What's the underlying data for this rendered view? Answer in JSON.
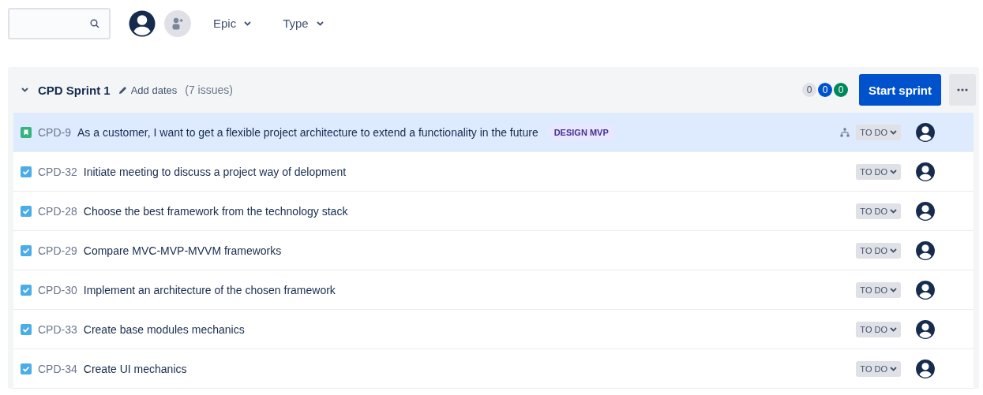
{
  "filters": [
    {
      "label": "Epic"
    },
    {
      "label": "Type"
    }
  ],
  "sprint": {
    "name": "CPD Sprint 1",
    "expanded": true,
    "add_dates": "Add dates",
    "issue_count": "(7 issues)",
    "counts": [
      {
        "value": "0",
        "color": "#dfe1e6"
      },
      {
        "value": "0",
        "color": "#0052cc"
      },
      {
        "value": "0",
        "color": "#00875a"
      }
    ],
    "start_button": "Start sprint"
  },
  "issues": [
    {
      "kind": "story",
      "key": "CPD-9",
      "summary": "As a customer, I want to get a flexible project architecture to extend a functionality in the future",
      "epic": "DESIGN MVP",
      "has_children": true,
      "status": "TO DO",
      "selected": true
    },
    {
      "kind": "task",
      "key": "CPD-32",
      "summary": "Initiate meeting to discuss a project way of delopment",
      "status": "TO DO",
      "selected": false
    },
    {
      "kind": "task",
      "key": "CPD-28",
      "summary": "Choose the best framework from the technology stack",
      "status": "TO DO",
      "selected": false
    },
    {
      "kind": "task",
      "key": "CPD-29",
      "summary": "Compare MVC-MVP-MVVM frameworks",
      "status": "TO DO",
      "selected": false
    },
    {
      "kind": "task",
      "key": "CPD-30",
      "summary": "Implement an architecture of the chosen framework",
      "status": "TO DO",
      "selected": false
    },
    {
      "kind": "task",
      "key": "CPD-33",
      "summary": "Create base modules mechanics",
      "status": "TO DO",
      "selected": false
    },
    {
      "kind": "task",
      "key": "CPD-34",
      "summary": "Create UI mechanics",
      "status": "TO DO",
      "selected": false
    }
  ]
}
